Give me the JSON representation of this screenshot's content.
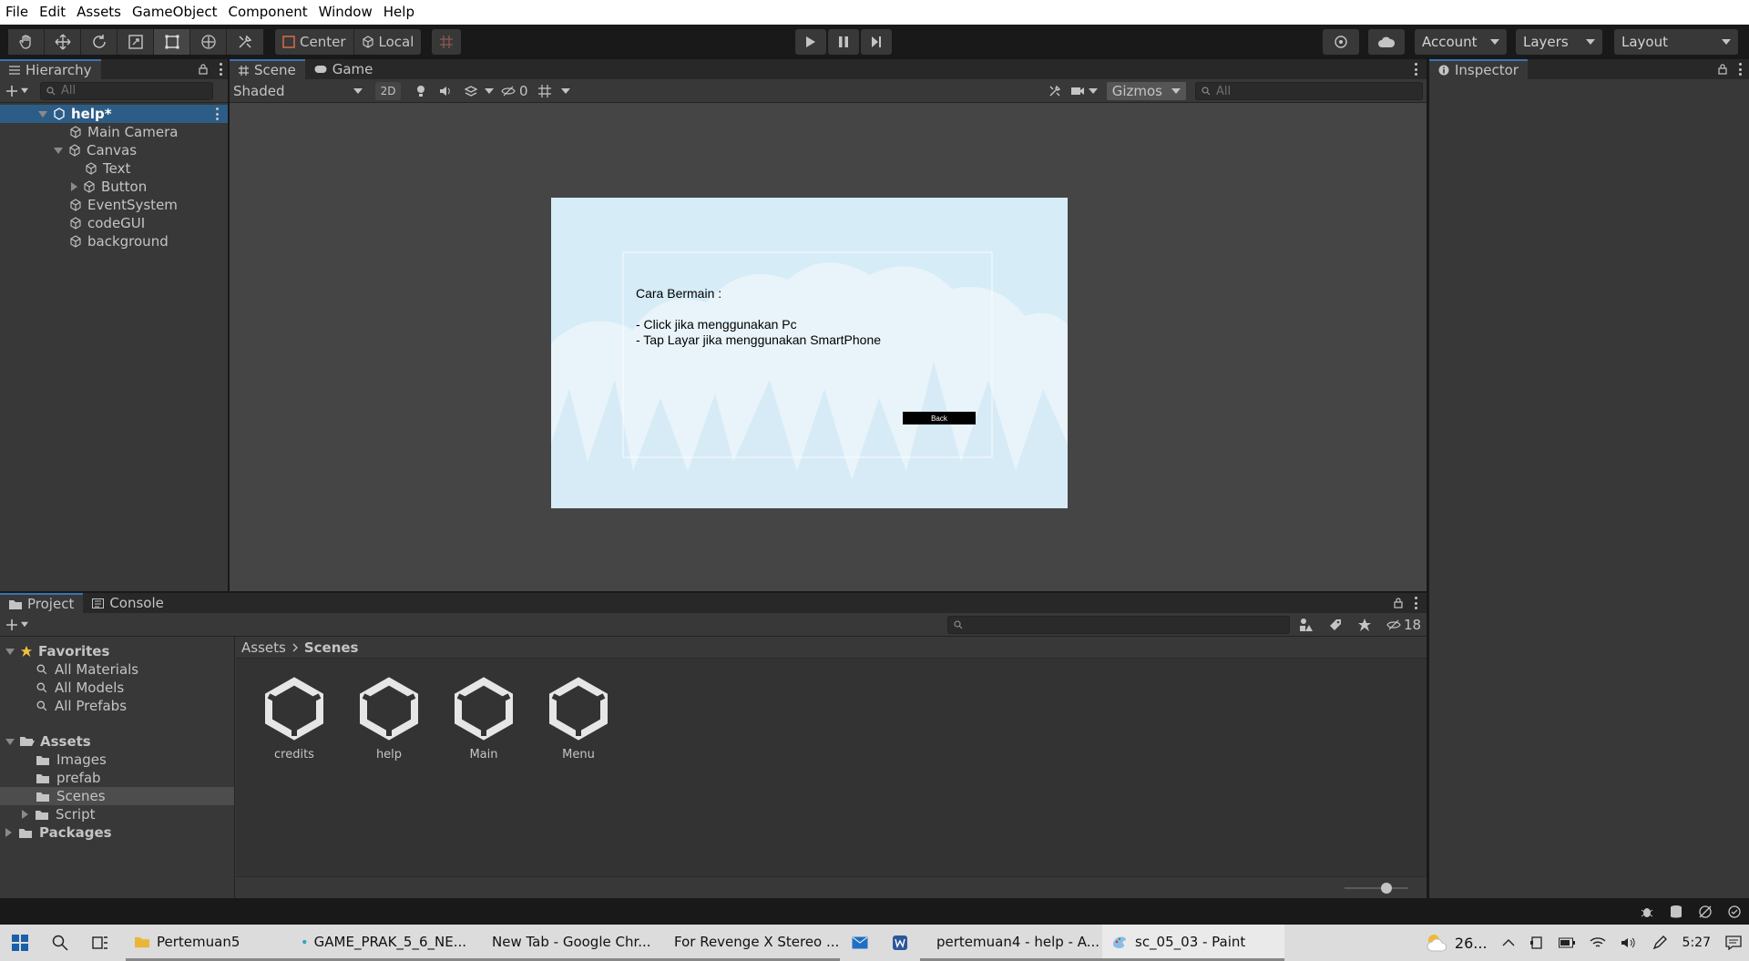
{
  "menu": [
    "File",
    "Edit",
    "Assets",
    "GameObject",
    "Component",
    "Window",
    "Help"
  ],
  "toolbar": {
    "pivot": "Center",
    "space": "Local",
    "account": "Account",
    "layers": "Layers",
    "layout": "Layout"
  },
  "hierarchy": {
    "tab": "Hierarchy",
    "search_placeholder": "All",
    "scene": "help*",
    "items": [
      "Main Camera",
      "Canvas",
      "Text",
      "Button",
      "EventSystem",
      "codeGUI",
      "background"
    ]
  },
  "scene_view": {
    "tabs": [
      "Scene",
      "Game"
    ],
    "shading": "Shaded",
    "mode_2d": "2D",
    "hidden_count": "0",
    "gizmos": "Gizmos",
    "search_placeholder": "All"
  },
  "game_ui": {
    "title": "Cara Bermain :",
    "line1": "- Click jika menggunakan Pc",
    "line2": "- Tap Layar jika menggunakan SmartPhone",
    "back": "Back",
    "sky_color": "#d6ecf7",
    "cloud_color": "#e8f4fa"
  },
  "inspector": {
    "tab": "Inspector"
  },
  "project": {
    "tabs": [
      "Project",
      "Console"
    ],
    "hidden_count": "18",
    "favorites_label": "Favorites",
    "favorites": [
      "All Materials",
      "All Models",
      "All Prefabs"
    ],
    "assets_label": "Assets",
    "folders": [
      "Images",
      "prefab",
      "Scenes",
      "Script"
    ],
    "packages_label": "Packages",
    "breadcrumb": [
      "Assets",
      "Scenes"
    ],
    "files": [
      "credits",
      "help",
      "Main",
      "Menu"
    ],
    "zoom_fraction": 0.65
  },
  "taskbar": {
    "items": [
      "Pertemuan5",
      "GAME_PRAK_5_6_NE...",
      "New Tab - Google Chr...",
      "For Revenge X Stereo ...",
      "pertemuan4 - help - A...",
      "sc_05_03 - Paint"
    ],
    "weather": "26...",
    "time": "5:27"
  },
  "colors": {
    "accent": "#3a72b0",
    "selection": "#2c5d87",
    "panel": "#383838"
  }
}
